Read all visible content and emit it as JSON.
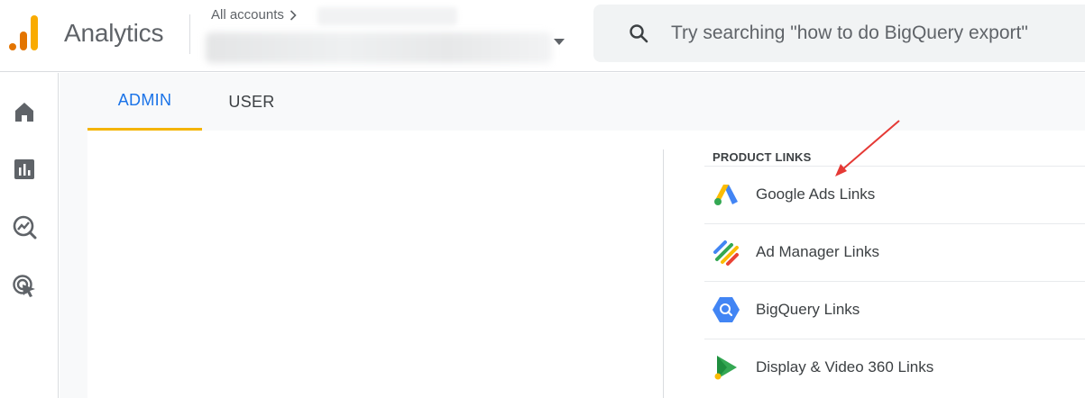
{
  "header": {
    "app_title": "Analytics",
    "breadcrumb": "All accounts",
    "search_placeholder": "Try searching \"how to do BigQuery export\""
  },
  "left_nav": {
    "items": [
      "home-icon",
      "reports-icon",
      "explore-icon",
      "advertising-icon"
    ]
  },
  "tabs": [
    {
      "label": "ADMIN",
      "active": true
    },
    {
      "label": "USER",
      "active": false
    }
  ],
  "product_links": {
    "heading": "PRODUCT LINKS",
    "items": [
      {
        "label": "Google Ads Links",
        "icon": "google-ads-icon"
      },
      {
        "label": "Ad Manager Links",
        "icon": "ad-manager-icon"
      },
      {
        "label": "BigQuery Links",
        "icon": "bigquery-icon"
      },
      {
        "label": "Display & Video 360 Links",
        "icon": "display-video-360-icon"
      }
    ]
  },
  "colors": {
    "accent_blue": "#1a73e8",
    "tab_underline": "#f4b400",
    "annotation_red": "#e53935"
  }
}
